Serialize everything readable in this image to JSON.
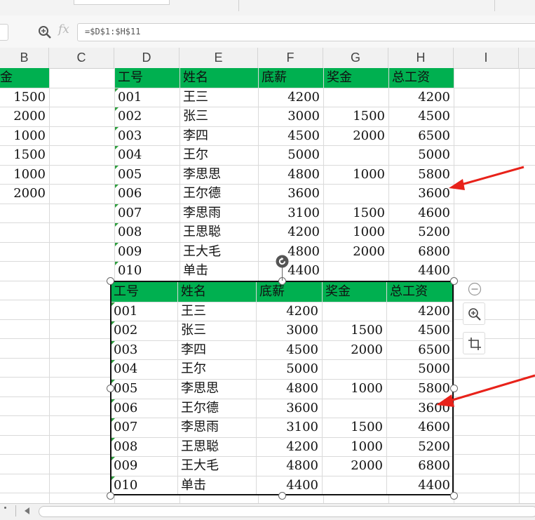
{
  "formula_bar": {
    "fx_label": "fx",
    "formula": "=$D$1:$H$11"
  },
  "columns": [
    "B",
    "C",
    "D",
    "E",
    "F",
    "G",
    "H",
    "I"
  ],
  "col_b": {
    "header": "金",
    "values": [
      "1500",
      "2000",
      "1000",
      "1500",
      "1000",
      "2000"
    ]
  },
  "table": {
    "headers": [
      "工号",
      "姓名",
      "底薪",
      "奖金",
      "总工资"
    ],
    "rows": [
      [
        "001",
        "王三",
        "4200",
        "",
        "4200"
      ],
      [
        "002",
        "张三",
        "3000",
        "1500",
        "4500"
      ],
      [
        "003",
        "李四",
        "4500",
        "2000",
        "6500"
      ],
      [
        "004",
        "王尔",
        "5000",
        "",
        "5000"
      ],
      [
        "005",
        "李思思",
        "4800",
        "1000",
        "5800"
      ],
      [
        "006",
        "王尔德",
        "3600",
        "",
        "3600"
      ],
      [
        "007",
        "李思雨",
        "3100",
        "1500",
        "4600"
      ],
      [
        "008",
        "王思聪",
        "4200",
        "1000",
        "5200"
      ],
      [
        "009",
        "王大毛",
        "4800",
        "2000",
        "6800"
      ],
      [
        "010",
        "单击",
        "4400",
        "",
        "4400"
      ]
    ]
  },
  "picture": {
    "headers": [
      "工号",
      "姓名",
      "底薪",
      "奖金",
      "总工资"
    ],
    "rows": [
      [
        "001",
        "王三",
        "4200",
        "",
        "4200"
      ],
      [
        "002",
        "张三",
        "3000",
        "1500",
        "4500"
      ],
      [
        "003",
        "李四",
        "4500",
        "2000",
        "6500"
      ],
      [
        "004",
        "王尔",
        "5000",
        "",
        "5000"
      ],
      [
        "005",
        "李思思",
        "4800",
        "1000",
        "5800"
      ],
      [
        "006",
        "王尔德",
        "3600",
        "",
        "3600"
      ],
      [
        "007",
        "李思雨",
        "3100",
        "1500",
        "4600"
      ],
      [
        "008",
        "王思聪",
        "4200",
        "1000",
        "5200"
      ],
      [
        "009",
        "王大毛",
        "4800",
        "2000",
        "6800"
      ],
      [
        "010",
        "单击",
        "4400",
        "",
        "4400"
      ]
    ]
  },
  "icons": {
    "zoom": "zoom-in-icon",
    "crop": "crop-icon",
    "collapse": "minus-circle-icon",
    "rotate": "rotate-icon",
    "arrows": "red-arrow-icon"
  },
  "colors": {
    "header_green": "#00b050",
    "arrow_red": "#e8221a"
  }
}
